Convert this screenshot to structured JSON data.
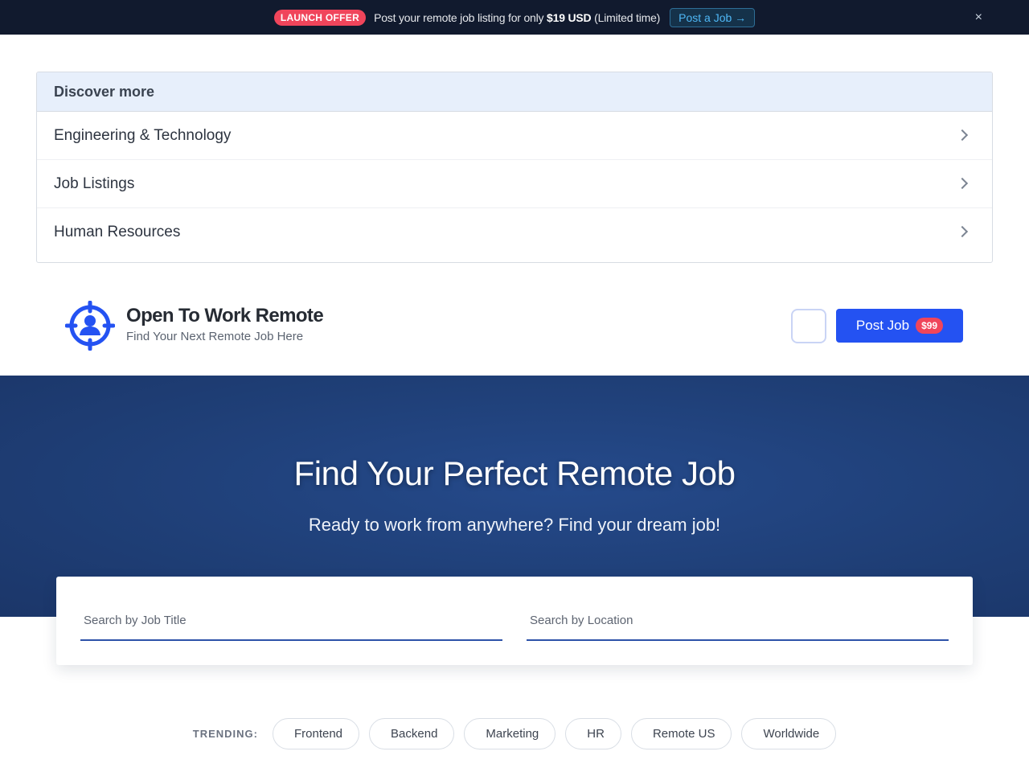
{
  "banner": {
    "badge": "LAUNCH OFFER",
    "text_before": "Post your remote job listing for only ",
    "price": "$19 USD",
    "text_after": " (Limited time)",
    "cta": "Post a Job →",
    "close": "×"
  },
  "discover": {
    "title": "Discover more",
    "items": [
      {
        "label": "Engineering & Technology"
      },
      {
        "label": "Job Listings"
      },
      {
        "label": "Human Resources"
      }
    ]
  },
  "header": {
    "brand_name": "Open To Work Remote",
    "tagline": "Find Your Next Remote Job Here",
    "theme_icon": "moon-icon",
    "theme_glyph": "",
    "post_button": "Post Job",
    "price_pill": "$99",
    "brand_color": "#2452f2"
  },
  "hero": {
    "title": "Find Your Perfect Remote Job",
    "subtitle": "Ready to work from anywhere? Find your dream job!"
  },
  "search": {
    "title_placeholder": "Search by Job Title",
    "location_placeholder": "Search by Location",
    "title_icon": "search-icon",
    "location_icon": "map-marker-icon",
    "glyph": ""
  },
  "trending": {
    "label": "TRENDING:",
    "chips": [
      {
        "label": "Frontend",
        "icon": "code-icon"
      },
      {
        "label": "Backend",
        "icon": "server-icon"
      },
      {
        "label": "Marketing",
        "icon": "bullhorn-icon"
      },
      {
        "label": "HR",
        "icon": "users-icon"
      },
      {
        "label": "Remote US",
        "icon": "flag-icon"
      },
      {
        "label": "Worldwide",
        "icon": "globe-icon"
      }
    ],
    "glyph": ""
  }
}
